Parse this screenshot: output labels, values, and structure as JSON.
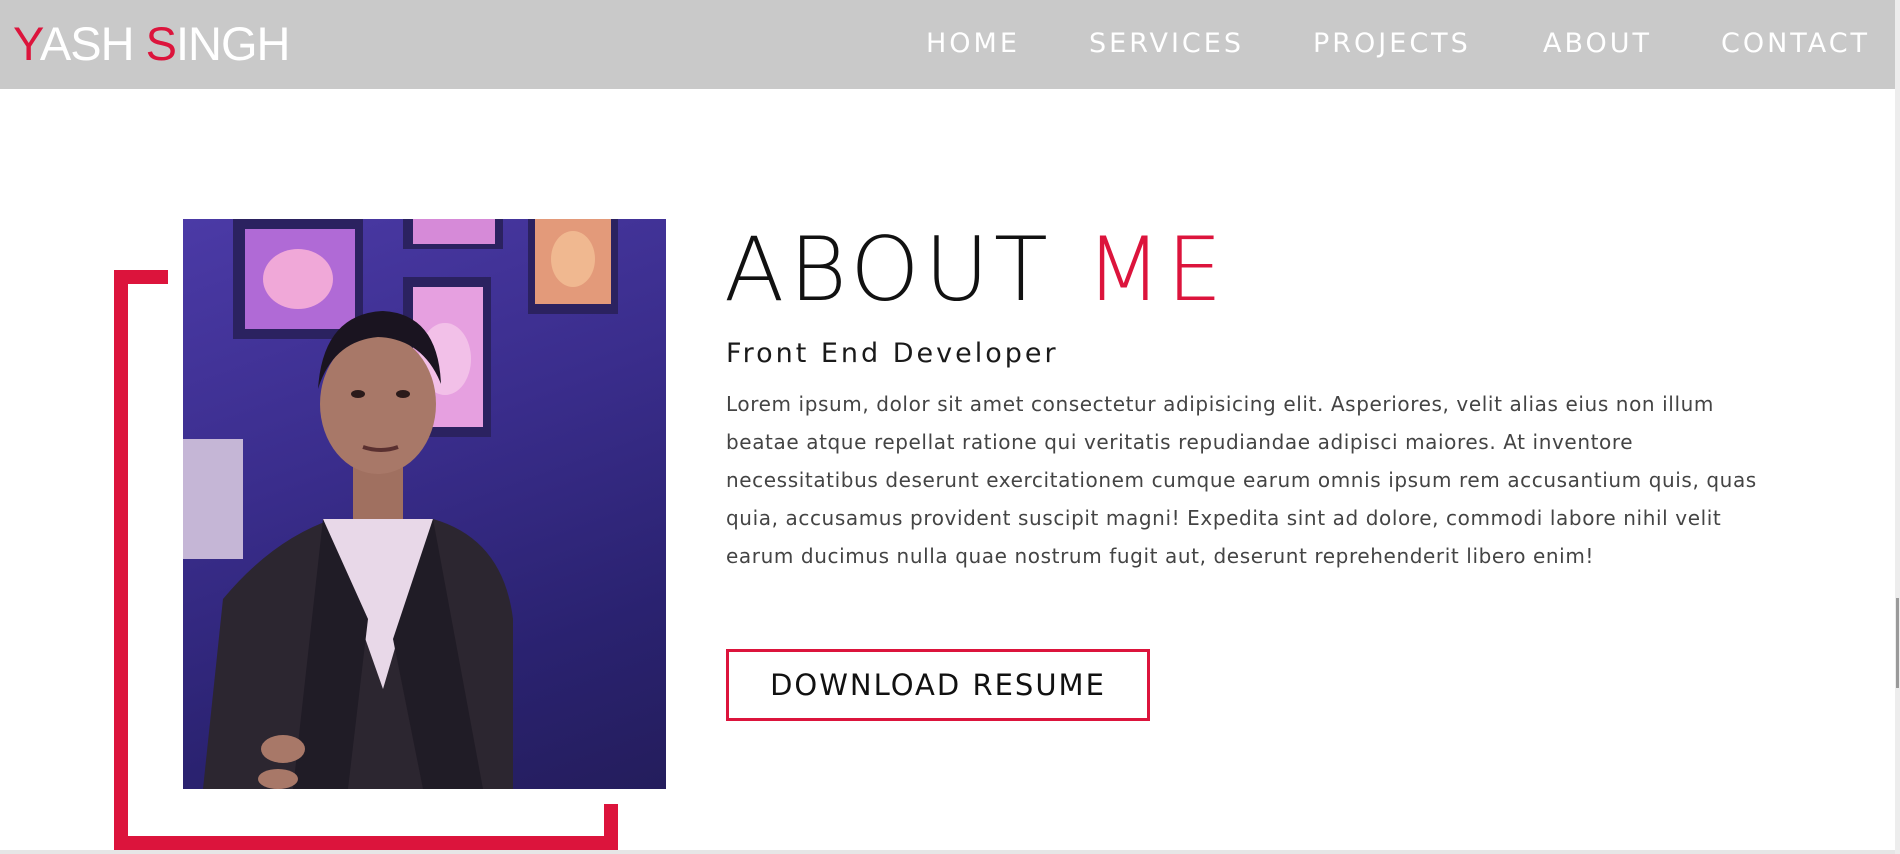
{
  "header": {
    "logo": {
      "part1": "Y",
      "part2": "ASH ",
      "part3": "S",
      "part4": "INGH"
    },
    "nav": [
      "HOME",
      "SERVICES",
      "PROJECTS",
      "ABOUT",
      "CONTACT"
    ]
  },
  "about": {
    "title_main": "ABOUT ",
    "title_accent": "ME",
    "subtitle": "Front End Developer",
    "bio": "Lorem ipsum, dolor sit amet consectetur adipisicing elit. Asperiores, velit alias eius non illum beatae atque repellat ratione qui veritatis repudiandae adipisci maiores. At inventore necessitatibus deserunt exercitationem cumque earum omnis ipsum rem accusantium quis, quas quia, accusamus provident suscipit magni! Expedita sint ad dolore, commodi labore nihil velit earum ducimus nulla quae nostrum fugit aut, deserunt reprehenderit libero enim!",
    "button_label": "DOWNLOAD RESUME"
  },
  "colors": {
    "accent": "#dc143c",
    "header_bg": "#c9c9c9",
    "text": "#111111"
  }
}
